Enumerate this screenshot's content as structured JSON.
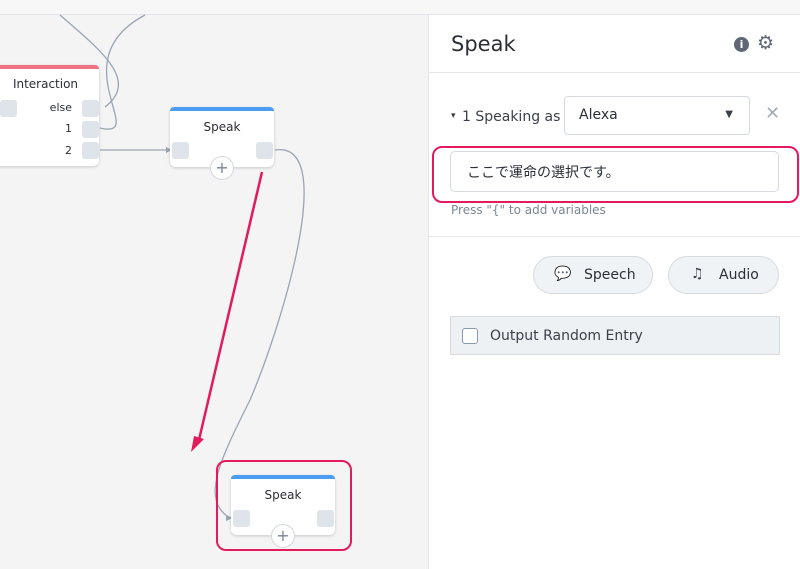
{
  "canvas": {
    "interaction_block": {
      "title": "Interaction",
      "ports": [
        "else",
        "1",
        "2"
      ],
      "bar_color": "#f07385"
    },
    "speak_block_top": {
      "title": "Speak",
      "bar_color": "#4a9df0"
    },
    "speak_block_bottom": {
      "title": "Speak",
      "bar_color": "#4a9df0"
    },
    "add_symbol": "+",
    "highlight_color": "#e31b5d"
  },
  "panel": {
    "title": "Speak",
    "info_icon": "i",
    "gear_icon": "⚙",
    "speak_entry": {
      "caret": "▾",
      "label": "1 Speaking as",
      "voice": "Alexa",
      "close_icon": "✕"
    },
    "text_value": "ここで運命の選択です。",
    "hint": "Press \"{\" to add variables",
    "buttons": {
      "speech": "Speech",
      "audio": "Audio"
    },
    "random": {
      "label": "Output Random Entry",
      "checked": false
    }
  }
}
